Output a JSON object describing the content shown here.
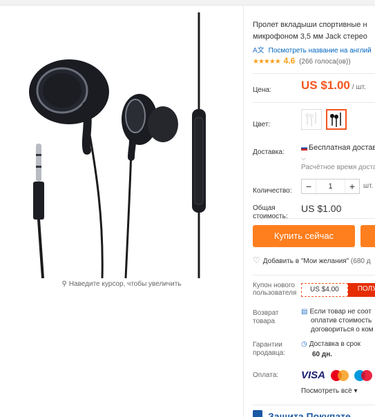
{
  "product": {
    "title_lines": [
      "Пролет вкладыши спортивные н",
      "микрофоном 3,5 мм Jack стерео"
    ],
    "translate_link": "Посмотреть название на англий",
    "rating": "4.6",
    "rating_stars": 4.6,
    "votes": "(266 голоса(ов))",
    "zoom_hint": "Наведите курсор, чтобы увеличить"
  },
  "price": {
    "label": "Цена:",
    "value": "US $1.00",
    "unit": "/ шт."
  },
  "color": {
    "label": "Цвет:",
    "options": [
      {
        "name": "white-variant",
        "selected": false
      },
      {
        "name": "black-variant",
        "selected": true
      }
    ]
  },
  "shipping": {
    "label": "Доставка:",
    "method": "Бесплатная доставка",
    "selector": "⌵",
    "estimate": "Расчётное время доста"
  },
  "quantity": {
    "label": "Количество:",
    "minus": "−",
    "value": "1",
    "plus": "+",
    "unit": "шт."
  },
  "total": {
    "label_line1": "Общая",
    "label_line2": "стоимость:",
    "value": "US $1.00"
  },
  "actions": {
    "buy_now": "Купить сейчас",
    "wishlist": "Добавить в \"Мои желания\"",
    "wishlist_count": "(680 д"
  },
  "coupon": {
    "label_lines": [
      "Купон нового",
      "пользователя"
    ],
    "amount": "US $4.00",
    "get": "ПОЛУ"
  },
  "returns": {
    "label_lines": [
      "Возврат",
      "товара"
    ],
    "text_lines": [
      "Если товар не соот",
      "оплатив стоимость",
      "договориться о ком"
    ]
  },
  "guarantee": {
    "label_lines": [
      "Гарантии",
      "продавца:"
    ],
    "text_line1": "Доставка в срок",
    "text_line2": "60 дн."
  },
  "payment": {
    "label": "Оплата:",
    "visa": "VISA",
    "see_all": "Посмотреть всё"
  },
  "protection": {
    "title": "Защита Покупате"
  },
  "colors": {
    "accent": "#f5541f",
    "button": "#ff7e1e",
    "link": "#0066c0",
    "star": "#f79f1a"
  }
}
